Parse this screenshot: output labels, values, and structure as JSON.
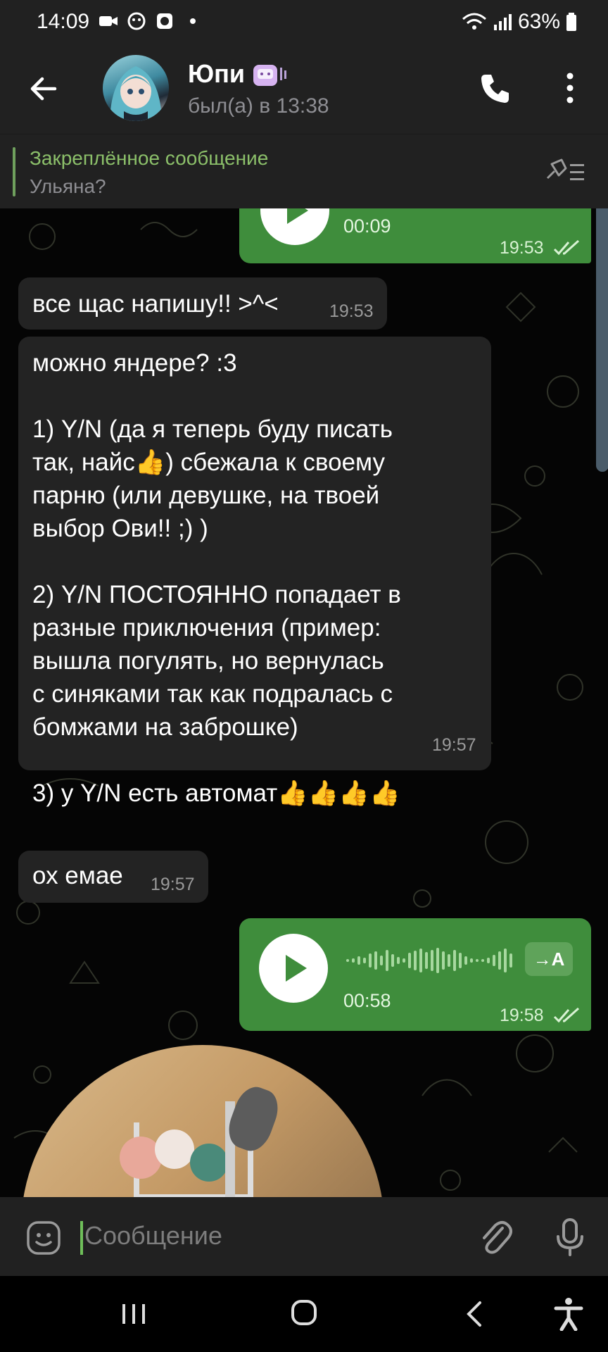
{
  "status_bar": {
    "time": "14:09",
    "battery": "63%"
  },
  "header": {
    "name": "Юпи",
    "status": "был(а) в 13:38"
  },
  "pinned": {
    "title": "Закреплённое сообщение",
    "text": "Ульяна?"
  },
  "messages": [
    {
      "type": "voice",
      "direction": "out",
      "duration": "00:09",
      "time": "19:53"
    },
    {
      "type": "text",
      "direction": "in",
      "text": "все щас напишу!! >^<",
      "time": "19:53"
    },
    {
      "type": "text",
      "direction": "in",
      "text": "можно яндере? :3\n\n1) Y/N (да я теперь буду писать\nтак, найс👍) сбежала к своему\nпарню (или девушке, на твоей\nвыбор Ови!! ;) )\n\n2) Y/N ПОСТОЯННО попадает в\nразные приключения (пример:\nвышла погулять, но вернулась\nс синяками так как подралась с\nбомжами на заброшке)\n\n3) у Y/N есть автомат👍👍👍👍",
      "time": "19:57"
    },
    {
      "type": "text",
      "direction": "in",
      "text": "ох емае",
      "time": "19:57"
    },
    {
      "type": "voice",
      "direction": "out",
      "duration": "00:58",
      "time": "19:58",
      "transcribe_label": "→A"
    }
  ],
  "input": {
    "placeholder": "Сообщение"
  },
  "colors": {
    "header_bg": "#212121",
    "outgoing_bubble": "#3f8d3c",
    "incoming_bubble": "#232323",
    "accent_green": "#8cc06a"
  }
}
